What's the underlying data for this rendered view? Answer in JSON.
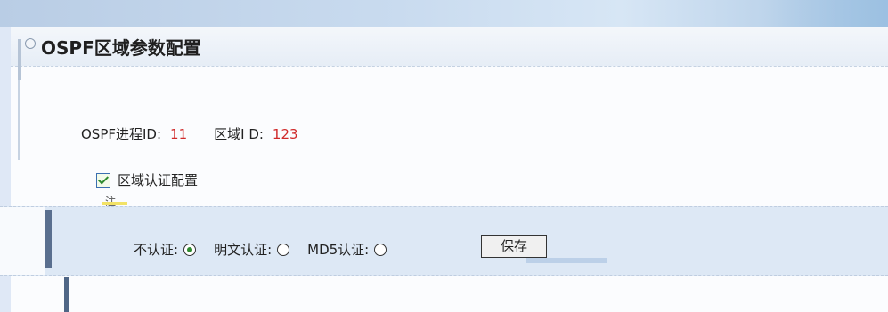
{
  "panel": {
    "title": "OSPF区域参数配置"
  },
  "info": {
    "process_id_label": "OSPF进程ID:",
    "process_id_value": "11",
    "area_id_label": "区域I D:",
    "area_id_value": "123"
  },
  "auth_config": {
    "label": "区域认证配置",
    "checked": true,
    "note": "注"
  },
  "auth_modes": {
    "none_label": "不认证:",
    "plain_label": "明文认证:",
    "md5_label": "MD5认证:",
    "selected": "none"
  },
  "actions": {
    "save_label": "保存"
  },
  "colors": {
    "accent_value": "#d02a2a",
    "check_green": "#2e8b2e",
    "band_blue": "#dde8f5"
  },
  "icons": {
    "panel": "panel-collapse-icon"
  }
}
